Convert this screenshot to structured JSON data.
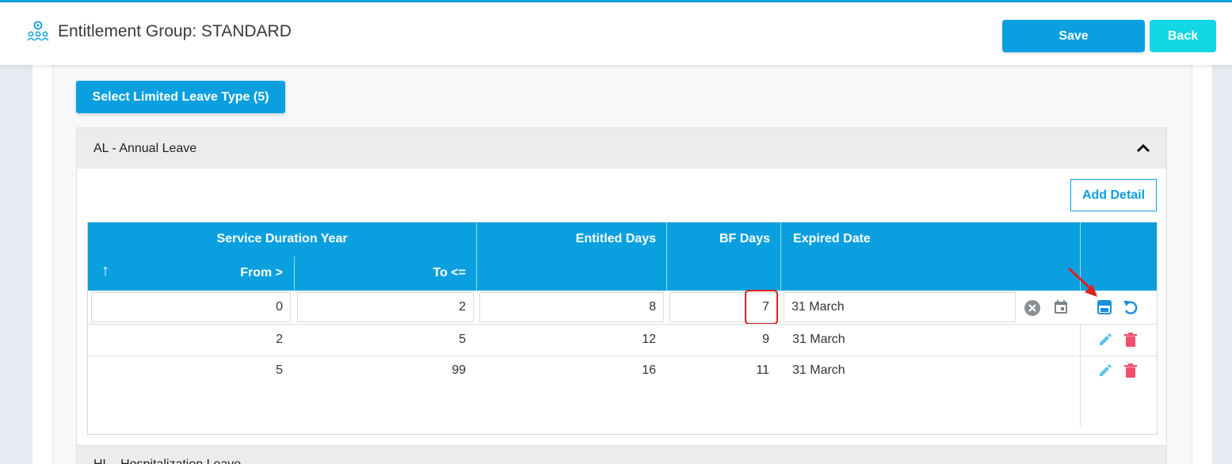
{
  "header": {
    "title": "Entitlement Group: STANDARD",
    "icon": "team-settings-icon",
    "save_label": "Save",
    "back_label": "Back"
  },
  "select_button_label": "Select Limited Leave Type (5)",
  "accordion": {
    "title": "AL - Annual Leave",
    "add_detail_label": "Add Detail",
    "columns": {
      "service_duration": "Service Duration Year",
      "sort_arrow": "↑",
      "from": "From >",
      "to": "To <=",
      "entitled_days": "Entitled Days",
      "bf_days": "BF Days",
      "expired_date": "Expired Date"
    },
    "edit_row": {
      "from": "0",
      "to": "2",
      "entitled_days": "8",
      "bf_days": "7",
      "expired_date": "31 March"
    },
    "rows": [
      {
        "from": "2",
        "to": "5",
        "entitled_days": "12",
        "bf_days": "9",
        "expired_date": "31 March"
      },
      {
        "from": "5",
        "to": "99",
        "entitled_days": "16",
        "bf_days": "11",
        "expired_date": "31 March"
      }
    ]
  },
  "next_accordion_title": "HL - Hospitalization Leave",
  "colors": {
    "primary": "#0aa0e0",
    "back": "#12d6e4",
    "delete": "#f0506e",
    "edit": "#5bc0eb",
    "highlight": "#e02020"
  }
}
